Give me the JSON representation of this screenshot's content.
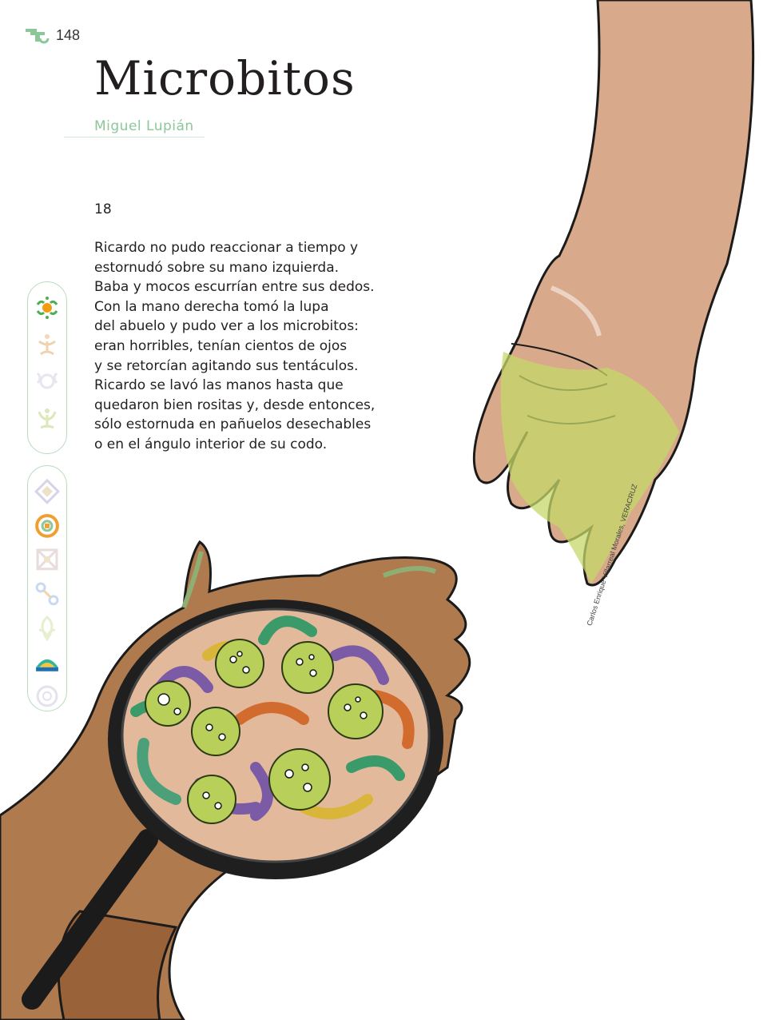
{
  "header": {
    "page_number": "148",
    "logo_icon": "stair-glyph-icon"
  },
  "story": {
    "title": "Microbitos",
    "author": "Miguel Lupián",
    "number": "18",
    "body": "Ricardo no pudo reaccionar a tiempo y\nestornudó sobre su mano izquierda.\nBaba y mocos escurrían entre sus dedos.\nCon la mano derecha tomó la lupa\ndel abuelo y pudo ver a los microbitos:\neran horribles, tenían cientos de ojos\ny se retorcían agitando sus tentáculos.\nRicardo se lavó las manos hasta que\nquedaron bien rositas y, desde entonces,\nsólo estornuda en pañuelos desechables\no en el ángulo interior de su codo."
  },
  "illustration": {
    "credit": "Carlos Enrique Villarreal Morales, VERACRUZ"
  },
  "side_nav": {
    "group1": [
      "sun-glyph-icon",
      "figure-glyph-icon",
      "ring-glyph-icon",
      "sprout-glyph-icon"
    ],
    "group2": [
      "diamond-glyph-icon",
      "spiral-glyph-icon",
      "cross-glyph-icon",
      "chain-glyph-icon",
      "leaf-glyph-icon",
      "dome-glyph-icon",
      "circle-glyph-icon"
    ]
  },
  "colors": {
    "accent": "#8cc79a",
    "skin_light": "#d6a98a",
    "skin_dark": "#a36a3f",
    "mucus": "#c6d86a",
    "lens_fill": "#e3b99c"
  }
}
